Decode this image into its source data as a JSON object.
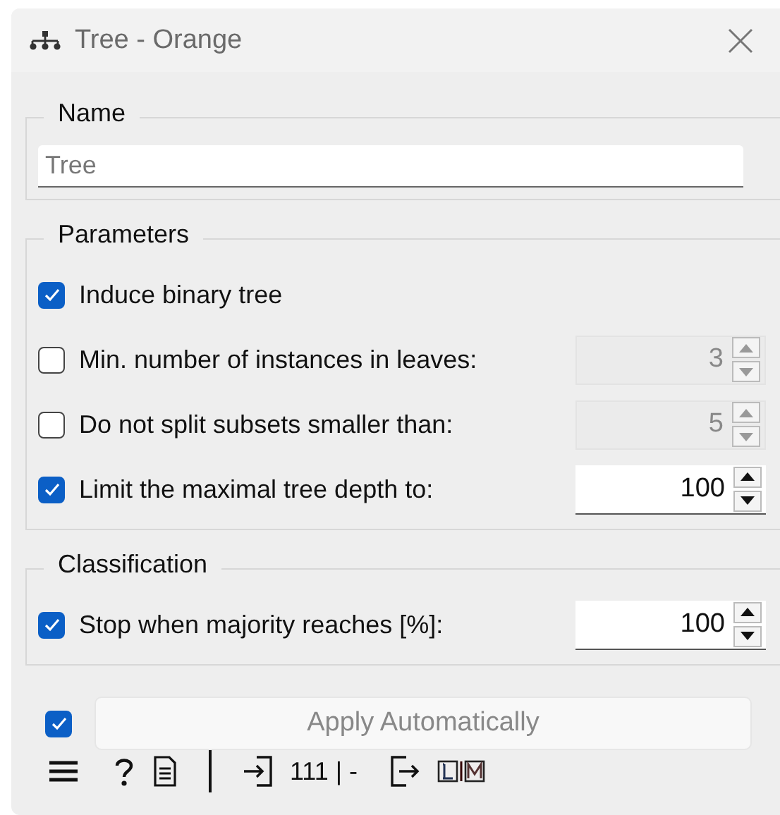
{
  "window": {
    "title": "Tree - Orange"
  },
  "name_box": {
    "title": "Name",
    "field": {
      "placeholder": "Tree"
    }
  },
  "parameters": {
    "title": "Parameters",
    "rows": [
      {
        "kind": "checkbox",
        "label": "Induce binary tree",
        "checked": true
      },
      {
        "kind": "spin",
        "label": "Min. number of instances in leaves:",
        "checked": false,
        "value": "3",
        "disabled": true
      },
      {
        "kind": "spin",
        "label": "Do not split subsets smaller than:",
        "checked": false,
        "value": "5",
        "disabled": true
      },
      {
        "kind": "spin",
        "label": "Limit the maximal tree depth to:",
        "checked": true,
        "value": "100",
        "disabled": false
      }
    ]
  },
  "classification": {
    "title": "Classification",
    "rows": [
      {
        "kind": "spin",
        "label": "Stop when majority reaches [%]:",
        "checked": true,
        "value": "100",
        "disabled": false
      }
    ]
  },
  "apply": {
    "checked": true,
    "label": "Apply Automatically",
    "disabled": true
  },
  "status_bar": {
    "input_summary": "111 | -"
  }
}
